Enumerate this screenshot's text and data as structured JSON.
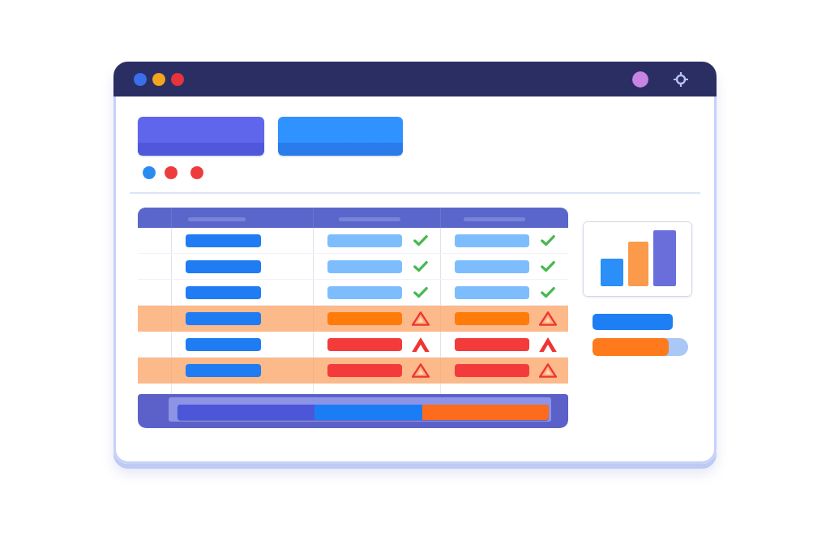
{
  "window": {
    "controls": [
      {
        "color": "#3b6fe9"
      },
      {
        "color": "#f5a41d"
      },
      {
        "color": "#e6343c"
      }
    ]
  },
  "toolbar": {
    "buttons": [
      {
        "color": "#5f66ec"
      },
      {
        "color": "#2f92fe"
      }
    ],
    "indicators": [
      {
        "color": "#2b8cf0"
      },
      {
        "color": "#ee3b3b"
      },
      {
        "color": "#ee3b3b"
      }
    ]
  },
  "table": {
    "columns": [
      {
        "kind": "blank"
      },
      {
        "kind": "label"
      },
      {
        "kind": "label"
      },
      {
        "kind": "label"
      }
    ],
    "rows": [
      {
        "highlighted": false,
        "cells": [
          {
            "kind": "blank"
          },
          {
            "kind": "name"
          },
          {
            "kind": "ok"
          },
          {
            "kind": "ok"
          }
        ]
      },
      {
        "highlighted": false,
        "cells": [
          {
            "kind": "blank"
          },
          {
            "kind": "name"
          },
          {
            "kind": "ok"
          },
          {
            "kind": "ok"
          }
        ]
      },
      {
        "highlighted": false,
        "cells": [
          {
            "kind": "blank"
          },
          {
            "kind": "name"
          },
          {
            "kind": "ok"
          },
          {
            "kind": "ok"
          }
        ]
      },
      {
        "highlighted": true,
        "cells": [
          {
            "kind": "blank"
          },
          {
            "kind": "name"
          },
          {
            "kind": "warning"
          },
          {
            "kind": "warning"
          }
        ]
      },
      {
        "highlighted": false,
        "cells": [
          {
            "kind": "blank"
          },
          {
            "kind": "name"
          },
          {
            "kind": "error"
          },
          {
            "kind": "error"
          }
        ]
      },
      {
        "highlighted": true,
        "cells": [
          {
            "kind": "blank"
          },
          {
            "kind": "name"
          },
          {
            "kind": "critical"
          },
          {
            "kind": "critical"
          }
        ]
      }
    ]
  },
  "summary_bar": {
    "track": {
      "color": "#1b7df5"
    },
    "start_fill": {
      "color": "#4b56d9",
      "level": 0.37
    },
    "end_fill": {
      "color": "#ff6b1c",
      "level": 0.34
    }
  },
  "side_panel": {
    "progress": {
      "level": 0.8
    }
  }
}
